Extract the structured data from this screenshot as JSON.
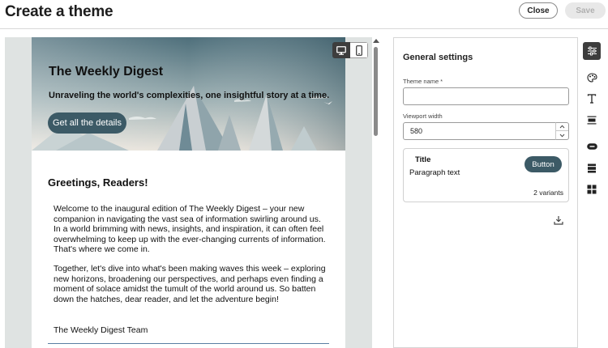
{
  "header": {
    "title": "Create a theme",
    "close_label": "Close",
    "save_label": "Save"
  },
  "email": {
    "hero_title": "The Weekly Digest",
    "hero_subtitle": "Unraveling the world's complexities, one insightful story at a time.",
    "hero_cta": "Get all the details",
    "greeting": "Greetings, Readers!",
    "paragraph1": "Welcome to the inaugural edition of The Weekly Digest – your new companion in navigating the vast sea of information swirling around us. In a world brimming with news, insights, and inspiration, it can often feel overwhelming to keep up with the ever-changing currents of information. That's where we come in.",
    "paragraph2": "Together, let's dive into what's been making waves this week – exploring new horizons, broadening our perspectives, and perhaps even finding a moment of solace amidst the tumult of the world around us. So batten down the hatches, dear reader, and let the adventure begin!",
    "signature": "The Weekly Digest Team"
  },
  "device_toggle": {
    "options": [
      "desktop-icon",
      "mobile-icon"
    ],
    "selected": "desktop"
  },
  "settings": {
    "panel_title": "General settings",
    "theme_name_label": "Theme name",
    "required_mark": "*",
    "theme_name_value": "",
    "viewport_label": "Viewport width",
    "viewport_value": "580",
    "preview": {
      "title": "Title",
      "paragraph": "Paragraph text",
      "button": "Button",
      "variants": "2 variants"
    }
  },
  "rail": {
    "items": [
      "settings-sliders-icon",
      "palette-icon",
      "typography-icon",
      "layout-icon",
      "button-style-icon",
      "section-icon",
      "grid-icon"
    ],
    "active": "settings-sliders-icon"
  },
  "colors": {
    "accent": "#3c5a66",
    "canvas_bg": "#dfe3e2",
    "save_disabled": "#e8e8e8"
  }
}
